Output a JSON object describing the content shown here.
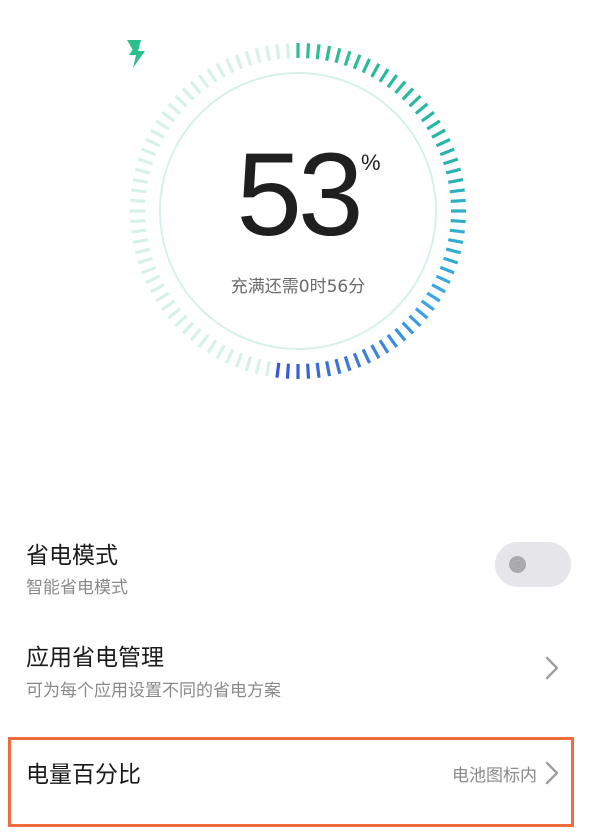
{
  "battery": {
    "percent_value": "53",
    "percent_sign": "%",
    "level_fraction": 0.53,
    "charge_time_text": "充满还需0时56分",
    "colors": {
      "ring_fill_start": "#2ec08b",
      "ring_fill_mid": "#24b7a6",
      "ring_fill_cyan": "#3aa6e6",
      "ring_fill_end": "#3a55d6",
      "ring_empty": "#d7f1ea",
      "inner_circle": "#d7f1ea",
      "bolt": "#2ec08b",
      "marker": "#2ec08b"
    },
    "icons": {
      "bolt": "lightning-bolt-icon",
      "marker": "triangle-marker-icon"
    }
  },
  "settings": {
    "power_saving": {
      "title": "省电模式",
      "subtitle": "智能省电模式",
      "toggle_state": "off"
    },
    "app_power_management": {
      "title": "应用省电管理",
      "subtitle": "可为每个应用设置不同的省电方案",
      "icon": "chevron-right-icon"
    },
    "battery_percentage": {
      "title": "电量百分比",
      "value": "电池图标内",
      "icon": "chevron-right-icon",
      "highlight_color": "#f06b3e"
    }
  }
}
